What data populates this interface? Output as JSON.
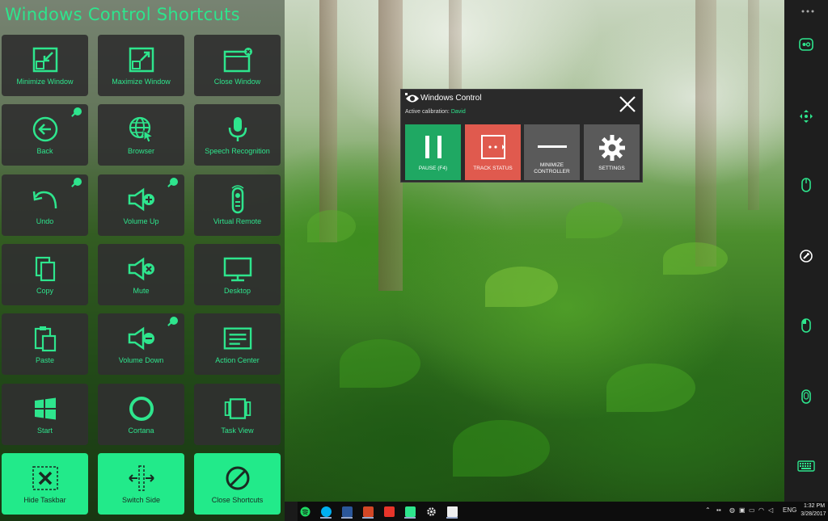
{
  "panel": {
    "title": "Windows Control Shortcuts",
    "tiles": [
      {
        "label": "Minimize Window",
        "icon": "minimize-window-icon"
      },
      {
        "label": "Maximize Window",
        "icon": "maximize-window-icon"
      },
      {
        "label": "Close Window",
        "icon": "close-window-icon"
      },
      {
        "label": "Back",
        "icon": "back-arrow-icon"
      },
      {
        "label": "Browser",
        "icon": "globe-icon"
      },
      {
        "label": "Speech Recognition",
        "icon": "microphone-icon"
      },
      {
        "label": "Undo",
        "icon": "undo-icon"
      },
      {
        "label": "Volume Up",
        "icon": "volume-up-icon"
      },
      {
        "label": "Virtual Remote",
        "icon": "remote-icon"
      },
      {
        "label": "Copy",
        "icon": "copy-icon"
      },
      {
        "label": "Mute",
        "icon": "mute-icon"
      },
      {
        "label": "Desktop",
        "icon": "monitor-icon"
      },
      {
        "label": "Paste",
        "icon": "paste-icon"
      },
      {
        "label": "Volume Down",
        "icon": "volume-down-icon"
      },
      {
        "label": "Action Center",
        "icon": "action-center-icon"
      },
      {
        "label": "Start",
        "icon": "windows-logo-icon"
      },
      {
        "label": "Cortana",
        "icon": "cortana-icon"
      },
      {
        "label": "Task View",
        "icon": "task-view-icon"
      }
    ],
    "actions": [
      {
        "label": "Hide Taskbar",
        "icon": "hide-taskbar-icon"
      },
      {
        "label": "Switch Side",
        "icon": "switch-side-icon"
      },
      {
        "label": "Close Shortcuts",
        "icon": "prohibited-icon"
      }
    ],
    "accent": "#2ee58d"
  },
  "popup": {
    "title": "Windows Control",
    "calibration_label": "Active calibration:",
    "calibration_name": "David",
    "buttons": [
      {
        "label": "PAUSE (F4)",
        "color": "#1fa863"
      },
      {
        "label": "TRACK STATUS",
        "color": "#e05a4e"
      },
      {
        "label": "MINIMIZE CONTROLLER",
        "color": "#5a5a5a"
      },
      {
        "label": "SETTINGS",
        "color": "#5a5a5a"
      }
    ]
  },
  "right_strip": {
    "icons": [
      "eye-tracker-icon",
      "move-arrows-icon",
      "mouse-icon",
      "eraser-icon",
      "mouse-left-click-icon",
      "mouse-right-click-icon",
      "keyboard-icon"
    ]
  },
  "taskbar": {
    "apps": [
      "spotify-icon",
      "skype-icon",
      "word-icon",
      "powerpoint-icon",
      "acrobat-icon",
      "app-icon",
      "settings-icon",
      "window-icon"
    ],
    "language": "ENG",
    "time": "1:32 PM",
    "date": "3/28/2017"
  }
}
